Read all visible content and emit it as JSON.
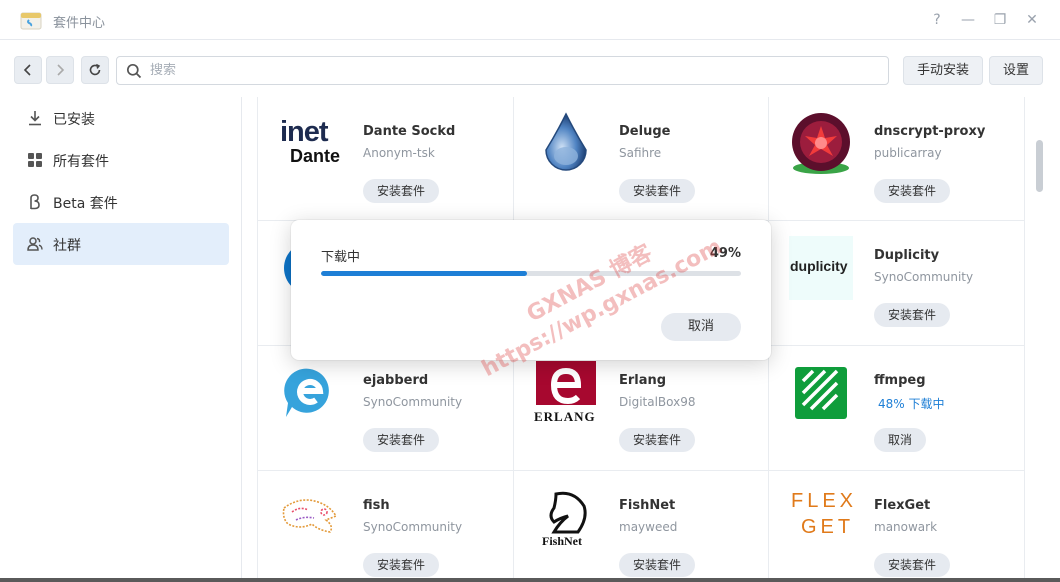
{
  "window": {
    "title": "套件中心",
    "help_glyph": "?",
    "min_glyph": "—",
    "max_glyph": "❐",
    "close_glyph": "✕"
  },
  "toolbar": {
    "search_placeholder": "搜索",
    "manual_install_label": "手动安装",
    "settings_label": "设置"
  },
  "sidebar": {
    "items": [
      {
        "label": "已安装",
        "icon": "download-icon"
      },
      {
        "label": "所有套件",
        "icon": "grid-icon"
      },
      {
        "label": "Beta 套件",
        "icon": "beta-icon"
      },
      {
        "label": "社群",
        "icon": "community-icon",
        "active": true
      }
    ]
  },
  "packages": [
    {
      "name": "Dante Sockd",
      "publisher": "Anonym-tsk",
      "action": "安装套件",
      "icon": "inet-dante-logo",
      "logo_line1": "inet",
      "logo_line2": "Dante"
    },
    {
      "name": "Deluge",
      "publisher": "Safihre",
      "action": "安装套件",
      "icon": "deluge-drop-logo"
    },
    {
      "name": "dnscrypt-proxy",
      "publisher": "publicarray",
      "action": "安装套件",
      "icon": "dnscrypt-logo"
    },
    {
      "name": "",
      "publisher": "",
      "action": "",
      "icon": "blue-circle-logo"
    },
    {
      "name": "",
      "publisher": "",
      "action": "",
      "icon": ""
    },
    {
      "name": "Duplicity",
      "publisher": "SynoCommunity",
      "action": "安装套件",
      "icon": "duplicity-logo",
      "logo_text": "duplicity"
    },
    {
      "name": "ejabberd",
      "publisher": "SynoCommunity",
      "action": "安装套件",
      "icon": "ejabberd-logo"
    },
    {
      "name": "Erlang",
      "publisher": "DigitalBox98",
      "action": "安装套件",
      "icon": "erlang-logo",
      "logo_text": "ERLANG"
    },
    {
      "name": "ffmpeg",
      "publisher": "",
      "status": "48% 下载中",
      "action": "取消",
      "icon": "ffmpeg-logo"
    },
    {
      "name": "fish",
      "publisher": "SynoCommunity",
      "action": "安装套件",
      "icon": "fish-logo"
    },
    {
      "name": "FishNet",
      "publisher": "mayweed",
      "action": "安装套件",
      "icon": "fishnet-logo",
      "logo_text": "FishNet"
    },
    {
      "name": "FlexGet",
      "publisher": "manowark",
      "action": "安装套件",
      "icon": "flexget-logo",
      "logo_line1": "FLEX",
      "logo_line2": "GET"
    }
  ],
  "download_dialog": {
    "title": "下载中",
    "percent_label": "49%",
    "progress": 0.49,
    "cancel_label": "取消"
  },
  "watermark": {
    "line1": "GXNAS 博客",
    "line2": "https://wp.gxnas.com"
  },
  "colors": {
    "accent": "#1e7fd6",
    "active_sidebar": "#e3eefb",
    "button_bg": "#e6eaf0"
  }
}
